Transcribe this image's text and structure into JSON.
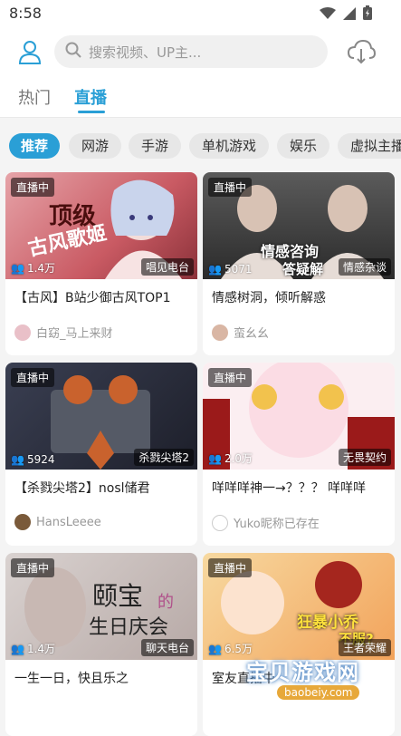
{
  "status_bar": {
    "time": "8:58"
  },
  "header": {
    "search_placeholder": "搜索视频、UP主..."
  },
  "tabs": [
    {
      "label": "热门"
    },
    {
      "label": "直播"
    }
  ],
  "categories": [
    "推荐",
    "网游",
    "手游",
    "单机游戏",
    "娱乐",
    "虚拟主播"
  ],
  "rooms": [
    {
      "status": "直播中",
      "viewers": "1.4万",
      "area": "唱见电台",
      "title": "【古风】B站少御古风TOP1",
      "up": "白窈_马上来财"
    },
    {
      "status": "直播中",
      "viewers": "5071",
      "area": "情感杂谈",
      "title": "情感树洞，倾听解惑",
      "up": "蛮幺幺"
    },
    {
      "status": "直播中",
      "viewers": "5924",
      "area": "杀戮尖塔2",
      "title": "【杀戮尖塔2】nosl储君",
      "up": "HansLeeee"
    },
    {
      "status": "直播中",
      "viewers": "2.0万",
      "area": "无畏契约",
      "title": "咩咩咩神一→？？？ 咩咩咩",
      "up": "Yuko昵称已存在"
    },
    {
      "status": "直播中",
      "viewers": "1.4万",
      "area": "聊天电台",
      "title": "一生一日，快且乐之",
      "up": ""
    },
    {
      "status": "直播中",
      "viewers": "6.5万",
      "area": "王者荣耀",
      "title": "室友直播中",
      "up": ""
    }
  ],
  "thumb_text": {
    "r0_a": "顶级",
    "r0_b": "古风歌姬",
    "r1_a": "情感咨询",
    "r1_b": "答疑解",
    "r4_a": "颐宝",
    "r4_b": "的",
    "r4_c": "生日庆会",
    "r5_a": "狂暴小乔",
    "r5_b": "不服?"
  },
  "watermark": {
    "main": "宝贝游戏网",
    "sub": "baobeiy.com"
  },
  "colors": {
    "accent": "#2a9fd6",
    "background": "#f4f4f4",
    "card": "#ffffff"
  }
}
